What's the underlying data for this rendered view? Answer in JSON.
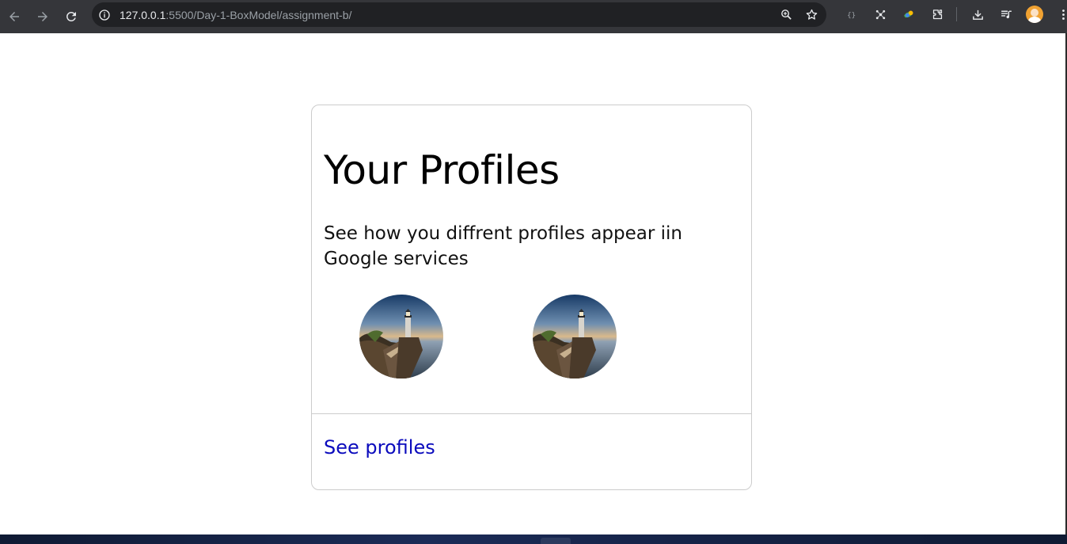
{
  "browser": {
    "url_host": "127.0.0.1",
    "url_rest": ":5500/Day-1-BoxModel/assignment-b/",
    "icons": [
      "back-arrow-icon",
      "forward-arrow-icon",
      "reload-icon",
      "site-info-icon",
      "zoom-icon",
      "bookmark-star-icon",
      "json-extension-icon",
      "extension-icon",
      "extension-icon",
      "extensions-puzzle-icon",
      "download-icon",
      "media-controls-icon",
      "profile-avatar",
      "menu-dots-icon"
    ]
  },
  "card": {
    "title": "Your Profiles",
    "description": "See how you diffrent profiles appear iin Google services",
    "profiles": [
      {
        "image": "lighthouse-profile-image"
      },
      {
        "image": "lighthouse-profile-image"
      }
    ],
    "link_label": "See profiles"
  },
  "colors": {
    "chrome_bg": "#35363a",
    "omnibox_bg": "#202124",
    "card_border": "#cccccc",
    "link": "#0b0bbd"
  }
}
